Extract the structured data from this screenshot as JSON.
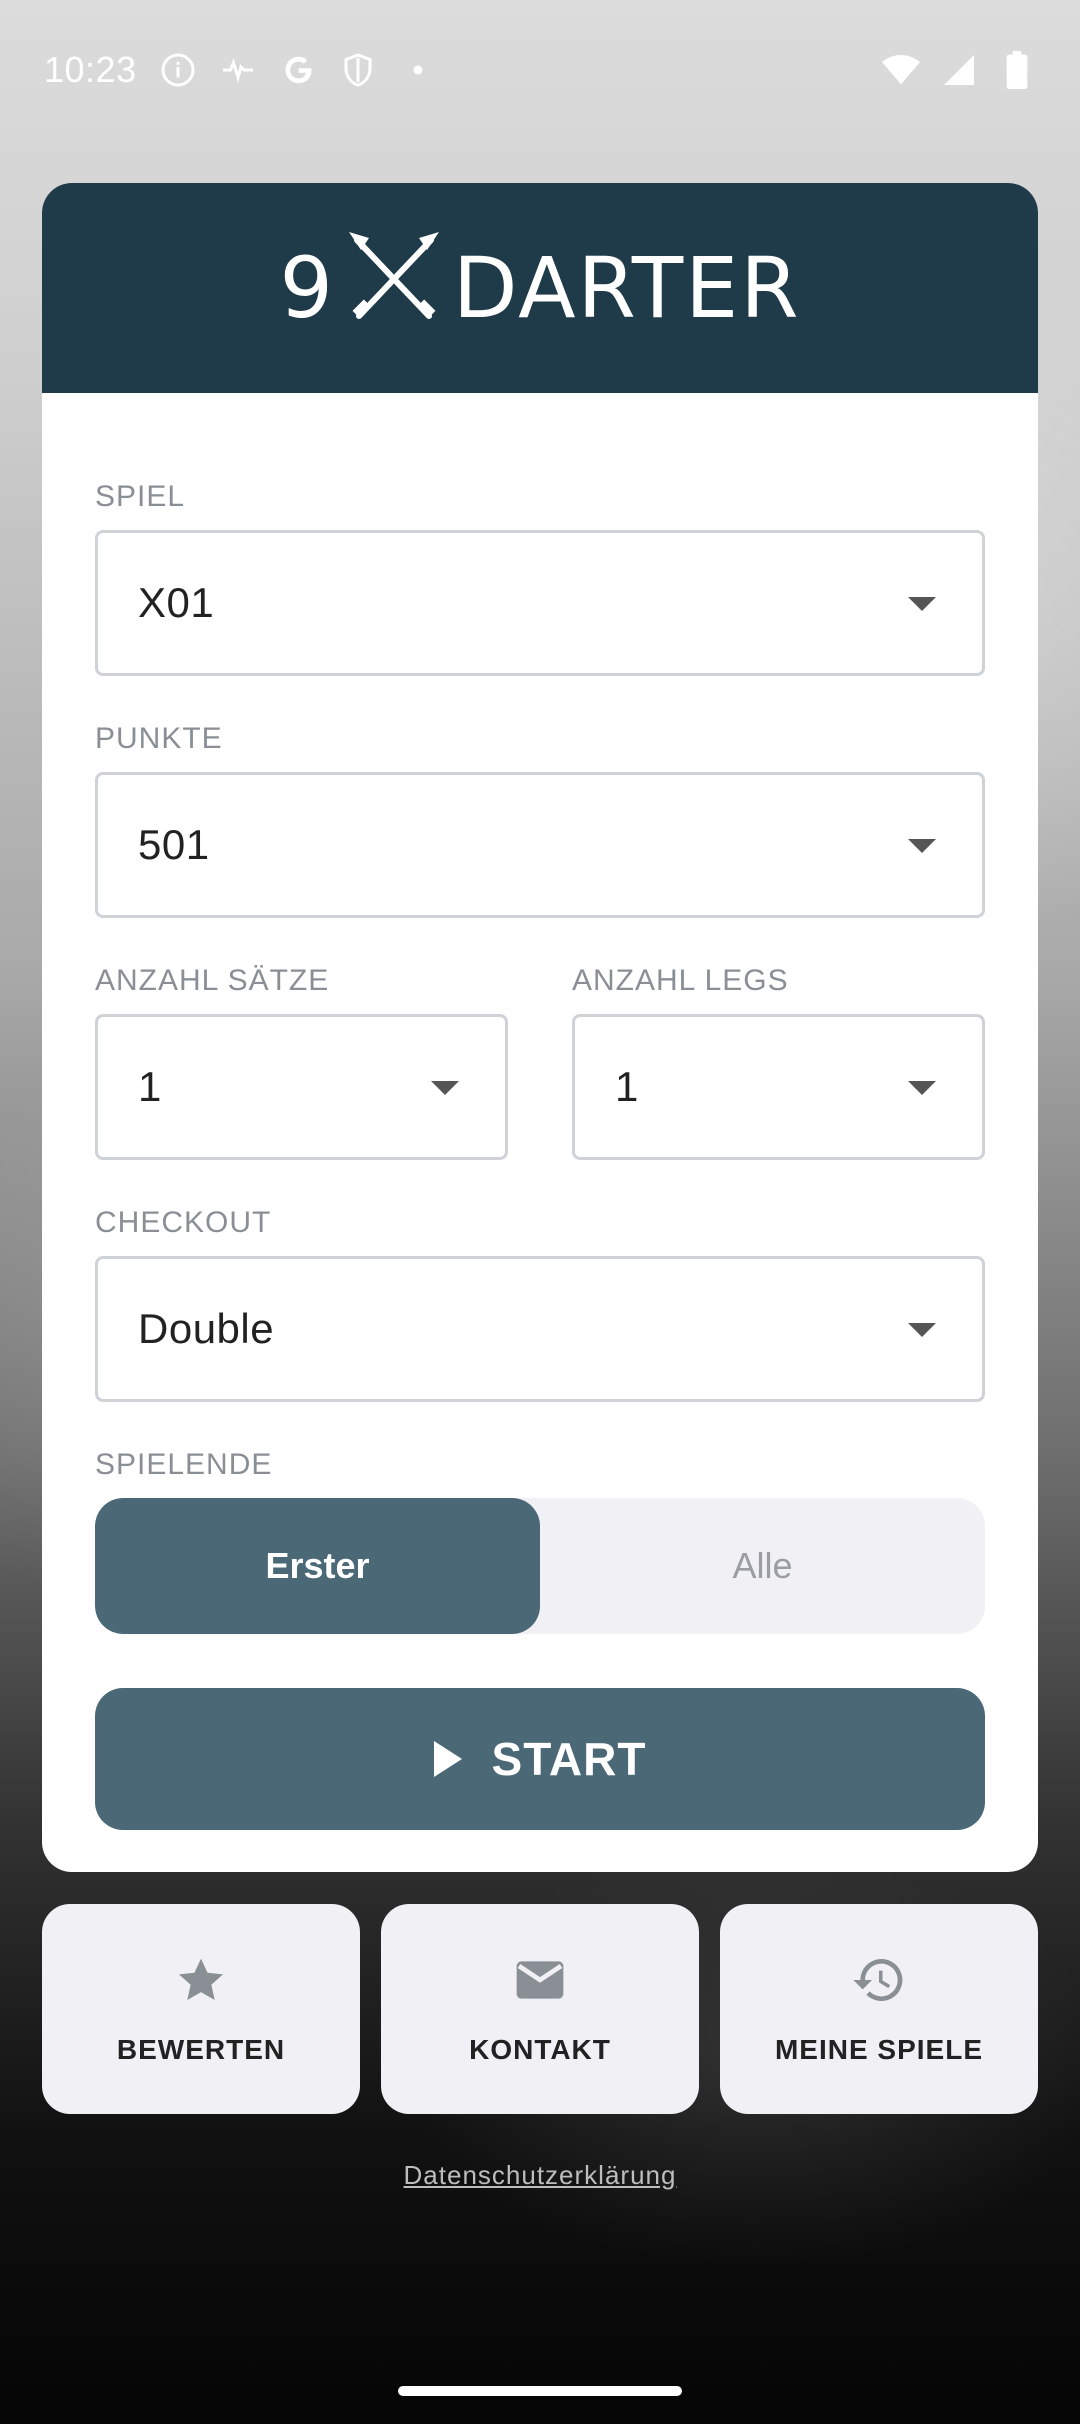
{
  "status_bar": {
    "time": "10:23",
    "icons_left": [
      "info-icon",
      "pulse-icon",
      "google-icon",
      "shield-icon",
      "dot-icon"
    ],
    "icons_right": [
      "wifi-icon",
      "signal-icon",
      "battery-icon"
    ]
  },
  "header": {
    "logo_number": "9",
    "logo_word": "DARTER"
  },
  "form": {
    "spiel": {
      "label": "SPIEL",
      "value": "X01"
    },
    "punkte": {
      "label": "PUNKTE",
      "value": "501"
    },
    "saetze": {
      "label": "ANZAHL SÄTZE",
      "value": "1"
    },
    "legs": {
      "label": "ANZAHL LEGS",
      "value": "1"
    },
    "checkout": {
      "label": "CHECKOUT",
      "value": "Double"
    },
    "spielende": {
      "label": "SPIELENDE",
      "options": [
        "Erster",
        "Alle"
      ],
      "selected": "Erster"
    },
    "start_label": "START"
  },
  "bottom_buttons": [
    {
      "label": "BEWERTEN",
      "icon": "star-icon"
    },
    {
      "label": "KONTAKT",
      "icon": "mail-icon"
    },
    {
      "label": "MEINE SPIELE",
      "icon": "history-icon"
    }
  ],
  "privacy_link": "Datenschutzerklärung",
  "colors": {
    "header_bg": "#1f3a48",
    "accent": "#4b6877",
    "tile_bg": "#f1f1f5"
  }
}
